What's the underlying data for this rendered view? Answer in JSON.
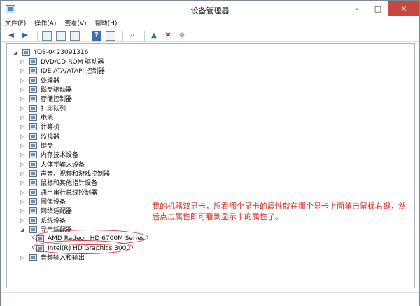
{
  "window": {
    "title": "设备管理器"
  },
  "menu": [
    {
      "label": "文件(F)"
    },
    {
      "label": "操作(A)"
    },
    {
      "label": "查看(V)"
    },
    {
      "label": "帮助(H)"
    }
  ],
  "tree": {
    "root": "YOS-0423091316",
    "categories": [
      {
        "label": "DVD/CD-ROM 驱动器",
        "expanded": false
      },
      {
        "label": "IDE ATA/ATAPI 控制器",
        "expanded": false
      },
      {
        "label": "处理器",
        "expanded": false
      },
      {
        "label": "磁盘驱动器",
        "expanded": false
      },
      {
        "label": "存储控制器",
        "expanded": false
      },
      {
        "label": "打印队列",
        "expanded": false
      },
      {
        "label": "电池",
        "expanded": false
      },
      {
        "label": "计算机",
        "expanded": false
      },
      {
        "label": "监视器",
        "expanded": false
      },
      {
        "label": "键盘",
        "expanded": false
      },
      {
        "label": "内存技术设备",
        "expanded": false
      },
      {
        "label": "人体学输入设备",
        "expanded": false
      },
      {
        "label": "声音、视频和游戏控制器",
        "expanded": false
      },
      {
        "label": "鼠标和其他指针设备",
        "expanded": false
      },
      {
        "label": "通用串行总线控制器",
        "expanded": false
      },
      {
        "label": "图像设备",
        "expanded": false
      },
      {
        "label": "网络适配器",
        "expanded": false
      },
      {
        "label": "系统设备",
        "expanded": false
      },
      {
        "label": "显示适配器",
        "expanded": true,
        "children": [
          {
            "label": "AMD Radeon HD 6700M Series"
          },
          {
            "label": "Intel(R) HD Graphics 3000"
          }
        ]
      },
      {
        "label": "音频输入和输出",
        "expanded": false
      }
    ]
  },
  "annotation": {
    "text": "我的机器双显卡，想看哪个显卡的属性就在哪个显卡上面单击鼠标右键，然后点击属性即可看到显示卡的属性了。",
    "color": "#d42a24"
  }
}
